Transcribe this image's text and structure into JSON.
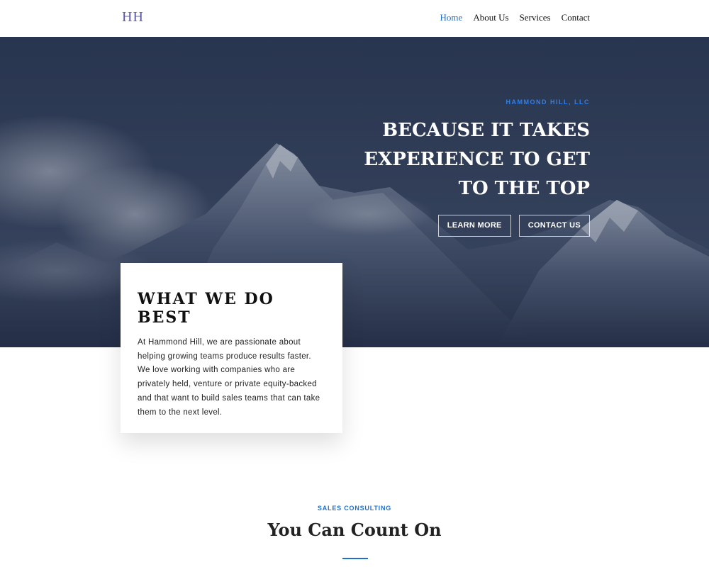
{
  "header": {
    "logo": "HH",
    "nav": [
      {
        "label": "Home",
        "active": true
      },
      {
        "label": "About Us",
        "active": false
      },
      {
        "label": "Services",
        "active": false
      },
      {
        "label": "Contact",
        "active": false
      }
    ]
  },
  "hero": {
    "eyebrow": "HAMMOND HILL, LLC",
    "headline_lines": [
      "BECAUSE IT TAKES",
      "EXPERIENCE TO GET",
      "TO THE TOP"
    ],
    "buttons": {
      "learn_more": "LEARN MORE",
      "contact_us": "CONTACT US"
    }
  },
  "card": {
    "title": "WHAT WE DO BEST",
    "text": "At Hammond Hill, we are passionate about helping growing teams produce results faster. We love working with companies who are privately held, venture or private equity-backed and that want to build sales teams that can take them to the next level."
  },
  "section": {
    "eyebrow": "SALES CONSULTING",
    "title": "You Can Count On"
  },
  "colors": {
    "accent": "#1f6fd0",
    "logo": "#5a5aa8",
    "hero_overlay": "#2f3d57"
  }
}
